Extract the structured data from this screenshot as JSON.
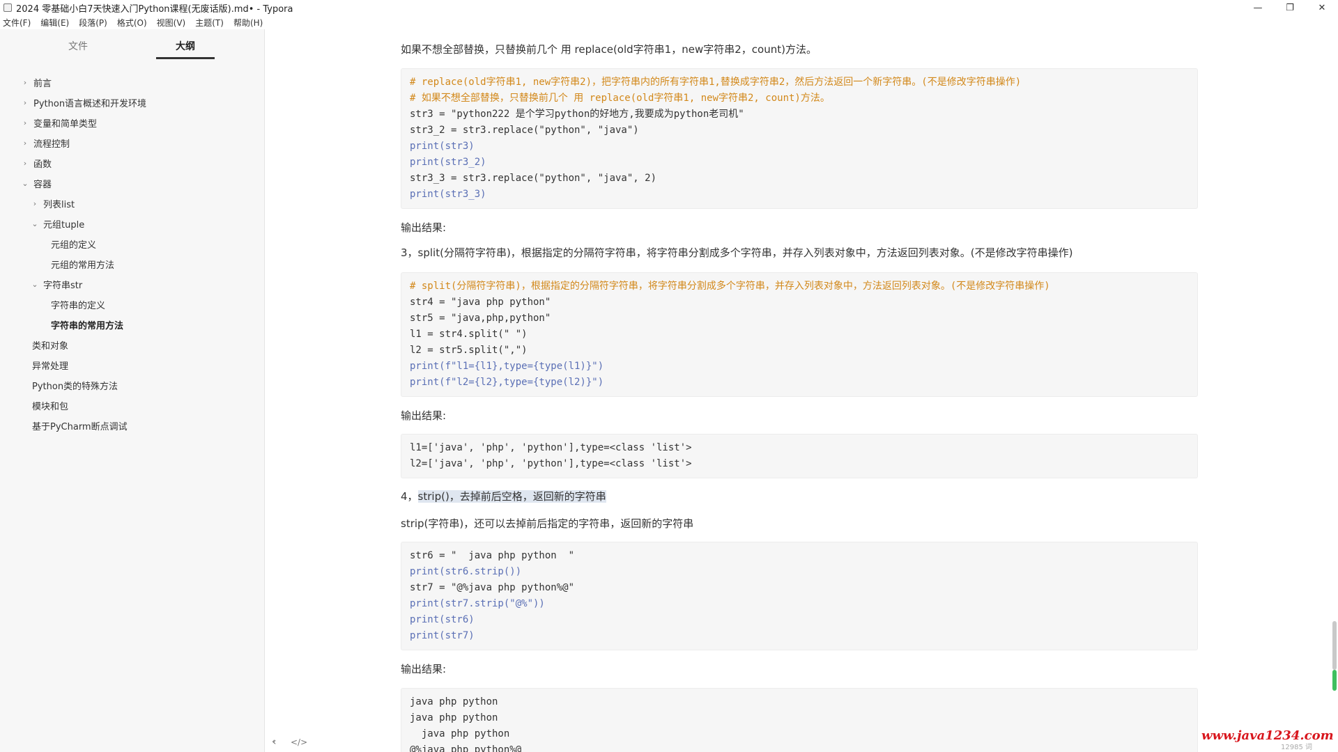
{
  "window": {
    "title": "2024 零基础小白7天快速入门Python课程(无废话版).md• - Typora",
    "minimize": "—",
    "restore": "❐",
    "close": "✕"
  },
  "menu": [
    "文件(F)",
    "编辑(E)",
    "段落(P)",
    "格式(O)",
    "视图(V)",
    "主题(T)",
    "帮助(H)"
  ],
  "sidebar": {
    "tabs": {
      "files": "文件",
      "outline": "大纲"
    },
    "outline": [
      {
        "label": "前言",
        "chevron": "›"
      },
      {
        "label": "Python语言概述和开发环境",
        "chevron": "›"
      },
      {
        "label": "变量和简单类型",
        "chevron": "›"
      },
      {
        "label": "流程控制",
        "chevron": "›"
      },
      {
        "label": "函数",
        "chevron": "›"
      },
      {
        "label": "容器",
        "chevron": "⌄"
      },
      {
        "label": "列表list",
        "chevron": "›"
      },
      {
        "label": "元组tuple",
        "chevron": "⌄"
      },
      {
        "label": "元组的定义",
        "chevron": ""
      },
      {
        "label": "元组的常用方法",
        "chevron": ""
      },
      {
        "label": "字符串str",
        "chevron": "⌄"
      },
      {
        "label": "字符串的定义",
        "chevron": ""
      },
      {
        "label": "字符串的常用方法",
        "chevron": ""
      },
      {
        "label": "类和对象",
        "chevron": ""
      },
      {
        "label": "异常处理",
        "chevron": ""
      },
      {
        "label": "Python类的特殊方法",
        "chevron": ""
      },
      {
        "label": "模块和包",
        "chevron": ""
      },
      {
        "label": "基于PyCharm断点调试",
        "chevron": ""
      }
    ],
    "footer": {
      "back": "‹",
      "source": "</>"
    }
  },
  "content": {
    "p1": "如果不想全部替换，只替换前几个 用 replace(old字符串1，new字符串2，count)方法。",
    "code1": [
      "# replace(old字符串1, new字符串2)，把字符串内的所有字符串1,替换成字符串2，然后方法返回一个新字符串。(不是修改字符串操作)",
      "# 如果不想全部替换，只替换前几个 用 replace(old字符串1, new字符串2, count)方法。",
      "str3 = \"python222 是个学习python的好地方,我要成为python老司机\"",
      "str3_2 = str3.replace(\"python\", \"java\")",
      "print(str3)",
      "print(str3_2)",
      "str3_3 = str3.replace(\"python\", \"java\", 2)",
      "print(str3_3)"
    ],
    "output_label_1": "输出结果:",
    "p_split": "3，split(分隔符字符串)，根据指定的分隔符字符串，将字符串分割成多个字符串，并存入列表对象中，方法返回列表对象。(不是修改字符串操作)",
    "code2": [
      "# split(分隔符字符串)，根据指定的分隔符字符串，将字符串分割成多个字符串，并存入列表对象中，方法返回列表对象。(不是修改字符串操作)",
      "str4 = \"java php python\"",
      "str5 = \"java,php,python\"",
      "l1 = str4.split(\" \")",
      "l2 = str5.split(\",\")",
      "print(f\"l1={l1},type={type(l1)}\")",
      "print(f\"l2={l2},type={type(l2)}\")"
    ],
    "output_label_2": "输出结果:",
    "code3": [
      "l1=['java', 'php', 'python'],type=<class 'list'>",
      "l2=['java', 'php', 'python'],type=<class 'list'>"
    ],
    "p4_prefix": "4，",
    "p4_highlight": "strip()，去掉前后空格，返回新的字符串",
    "p5": "strip(字符串)，还可以去掉前后指定的字符串，返回新的字符串",
    "code4": [
      "str6 = \"  java php python  \"",
      "print(str6.strip())",
      "str7 = \"@%java php python%@\"",
      "print(str7.strip(\"@%\"))",
      "print(str6)",
      "print(str7)"
    ],
    "output_label_3": "输出结果:",
    "code5": [
      "java php python",
      "java php python",
      "  java php python",
      "@%java php python%@"
    ]
  },
  "watermark": "www.java1234.com",
  "wordcount": "12985 词"
}
